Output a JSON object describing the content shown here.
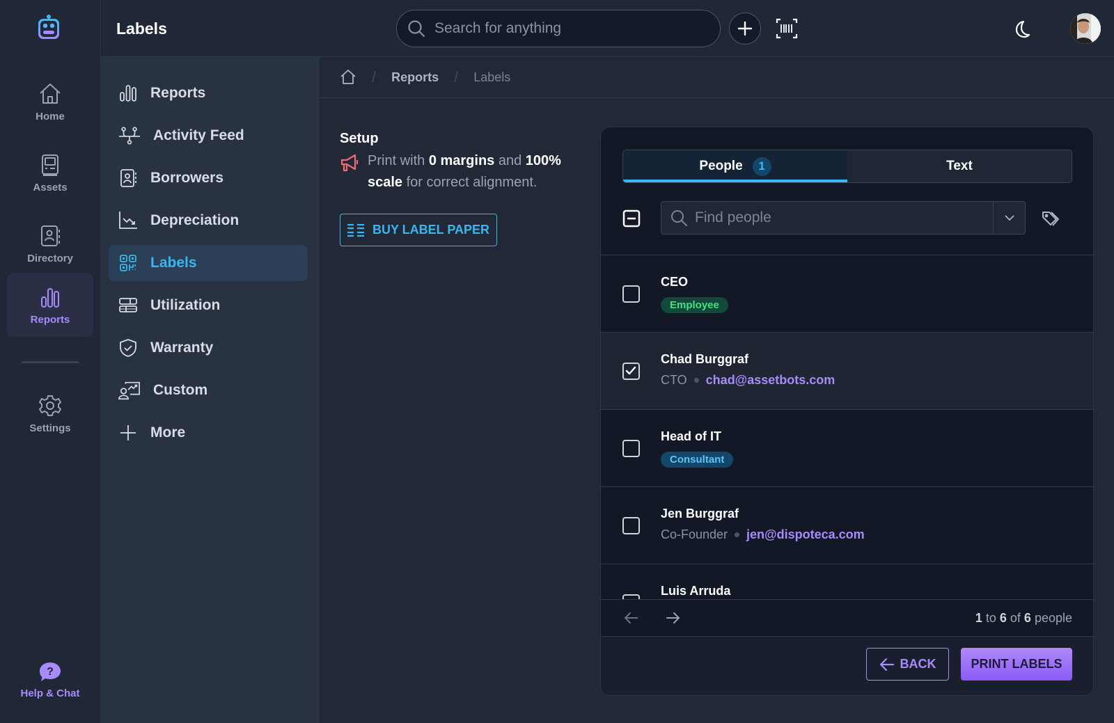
{
  "app": {
    "page_title": "Labels"
  },
  "rail": {
    "items": [
      {
        "label": "Home",
        "icon": "home-icon"
      },
      {
        "label": "Assets",
        "icon": "assets-icon"
      },
      {
        "label": "Directory",
        "icon": "directory-icon"
      },
      {
        "label": "Reports",
        "icon": "reports-icon",
        "active": true
      },
      {
        "label": "Settings",
        "icon": "gear-icon"
      }
    ],
    "help_label": "Help & Chat"
  },
  "header": {
    "search_placeholder": "Search for anything"
  },
  "subnav": {
    "items": [
      {
        "label": "Reports",
        "icon": "bar-chart-icon"
      },
      {
        "label": "Activity Feed",
        "icon": "activity-feed-icon"
      },
      {
        "label": "Borrowers",
        "icon": "contact-book-icon"
      },
      {
        "label": "Depreciation",
        "icon": "trend-down-icon"
      },
      {
        "label": "Labels",
        "icon": "qr-code-icon",
        "active": true
      },
      {
        "label": "Utilization",
        "icon": "table-icon"
      },
      {
        "label": "Warranty",
        "icon": "shield-check-icon"
      },
      {
        "label": "Custom",
        "icon": "custom-report-icon"
      },
      {
        "label": "More",
        "icon": "plus-icon"
      }
    ]
  },
  "breadcrumb": {
    "items": [
      "Reports",
      "Labels"
    ]
  },
  "setup": {
    "title": "Setup",
    "note_parts": [
      "Print with ",
      "0 margins",
      " and ",
      "100% scale",
      " for correct alignment."
    ],
    "buy_button": "BUY LABEL PAPER"
  },
  "panel": {
    "tabs": [
      {
        "label": "People",
        "count": "1",
        "active": true
      },
      {
        "label": "Text"
      }
    ],
    "find_placeholder": "Find people",
    "people": [
      {
        "name": "CEO",
        "badge": "Employee",
        "badge_bg": "#114a3a",
        "badge_fg": "#4ade80",
        "checked": false
      },
      {
        "name": "Chad Burggraf",
        "role": "CTO",
        "email": "chad@assetbots.com",
        "checked": true
      },
      {
        "name": "Head of IT",
        "badge": "Consultant",
        "badge_bg": "#14466a",
        "badge_fg": "#5cc4f5",
        "checked": false
      },
      {
        "name": "Jen Burggraf",
        "role": "Co-Founder",
        "email": "jen@dispoteca.com",
        "checked": false
      },
      {
        "name": "Luis Arruda",
        "checked": false
      }
    ],
    "pager": {
      "from": "1",
      "to_word": " to ",
      "to": "6",
      "of_word": " of ",
      "total": "6",
      "unit": " people"
    },
    "back_button": "BACK",
    "print_button": "PRINT LABELS"
  },
  "colors": {
    "accent_blue": "#38b6f0",
    "accent_purple": "#a78bfa",
    "megaphone_red": "#f26b7a"
  }
}
